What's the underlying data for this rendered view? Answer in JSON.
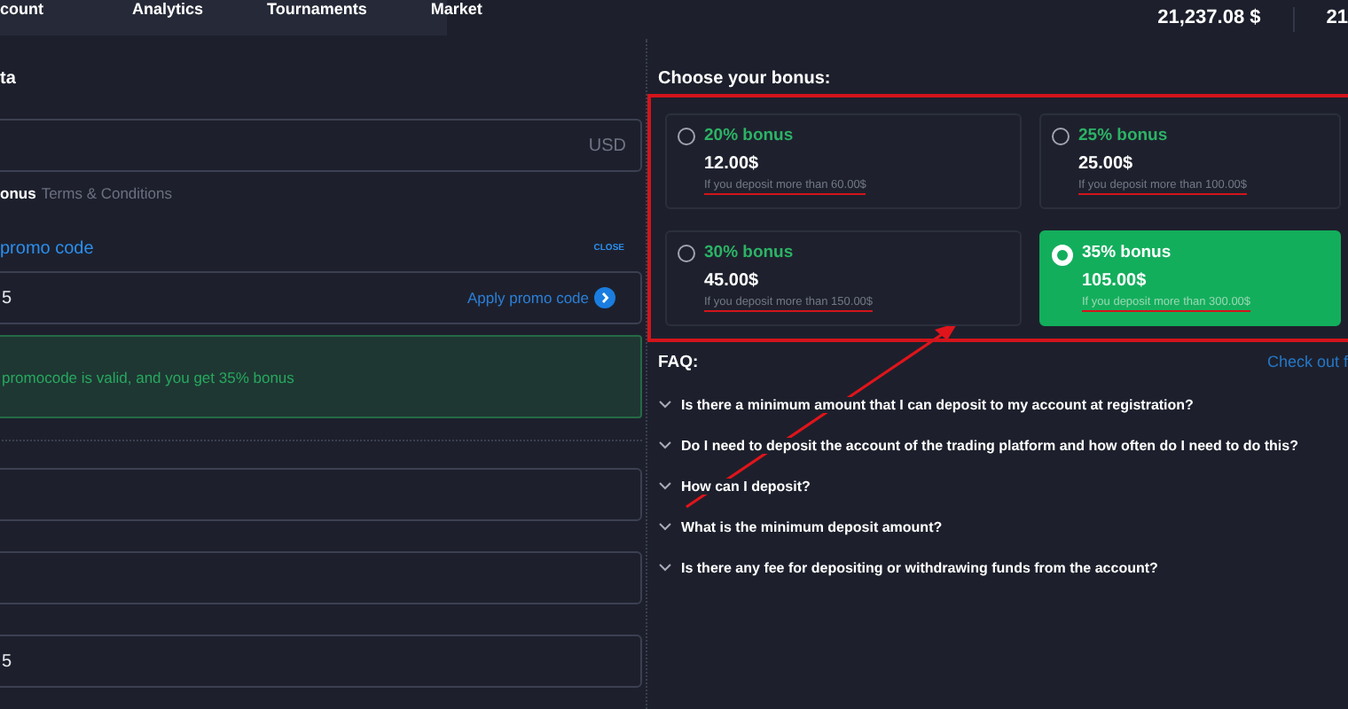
{
  "nav": {
    "items": [
      {
        "label": "count",
        "selected": false
      },
      {
        "label": "Analytics",
        "selected": false
      },
      {
        "label": "Tournaments",
        "selected": false
      },
      {
        "label": "Market",
        "selected": false
      }
    ]
  },
  "balances": [
    {
      "value": "21,237.08 $"
    },
    {
      "value": "21"
    }
  ],
  "form": {
    "title": "ta",
    "amount": {
      "suffix": "USD"
    },
    "bonus_note": {
      "bold": "onus",
      "link": "Terms & Conditions"
    },
    "promo": {
      "title": "promo code",
      "close": "CLOSE",
      "value": "5",
      "apply": "Apply promo code",
      "message": "promocode is valid, and you get 35% bonus"
    },
    "fields": [
      {
        "kind": "blank"
      },
      {
        "kind": "blank"
      },
      {
        "kind": "filled",
        "value": "5"
      }
    ]
  },
  "bonus": {
    "title": "Choose your bonus:",
    "annotated": true,
    "options": [
      {
        "label": "20% bonus",
        "amount": "12.00$",
        "condition": "If you deposit more than 60.00$",
        "selected": false,
        "underlined": true
      },
      {
        "label": "25% bonus",
        "amount": "25.00$",
        "condition": "If you deposit more than 100.00$",
        "selected": false,
        "underlined": true
      },
      {
        "label": "30% bonus",
        "amount": "45.00$",
        "condition": "If you deposit more than 150.00$",
        "selected": false,
        "underlined": true
      },
      {
        "label": "35% bonus",
        "amount": "105.00$",
        "condition": "If you deposit more than 300.00$",
        "selected": true,
        "underlined": true
      }
    ]
  },
  "faq": {
    "title": "FAQ:",
    "link": "Check out f",
    "annotation_arrow": true,
    "items": [
      {
        "question": "Is there a minimum amount that I can deposit to my account at registration?",
        "expanded": false
      },
      {
        "question": "Do I need to deposit the account of the trading platform and how often do I need to do this?",
        "expanded": false
      },
      {
        "question": "How can I deposit?",
        "expanded": false
      },
      {
        "question": "What is the minimum deposit amount?",
        "expanded": false
      },
      {
        "question": "Is there any fee for depositing or withdrawing funds from the account?",
        "expanded": false
      }
    ]
  }
}
